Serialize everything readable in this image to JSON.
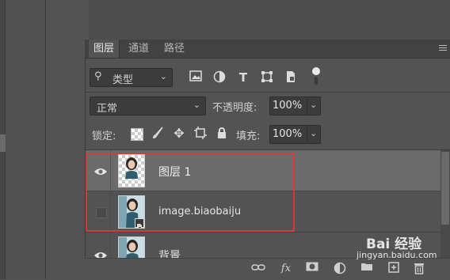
{
  "tabs": [
    {
      "label": "图层",
      "active": true
    },
    {
      "label": "通道",
      "active": false
    },
    {
      "label": "路径",
      "active": false
    }
  ],
  "filter": {
    "kind_label": "类型",
    "icons": [
      "image-filter-icon",
      "adjustment-filter-icon",
      "type-filter-icon",
      "shape-filter-icon",
      "smart-object-filter-icon",
      "filter-toggle-icon"
    ]
  },
  "blend": {
    "mode": "正常",
    "opacity_label": "不透明度:",
    "opacity_value": "100%"
  },
  "lock": {
    "label": "锁定:",
    "fill_label": "填充:",
    "fill_value": "100%"
  },
  "layers": [
    {
      "name": "图层 1",
      "visible": true,
      "selected": true
    },
    {
      "name": "image.biaobaiju",
      "visible": false,
      "selected": false
    },
    {
      "name": "背景",
      "visible": true,
      "selected": false
    }
  ],
  "watermark": {
    "brand": "Bai 经验",
    "url": "jingyan.baidu.com"
  },
  "colors": {
    "highlight": "#d43a3a",
    "selected_row": "#6b6b6b",
    "panel": "#535353"
  }
}
